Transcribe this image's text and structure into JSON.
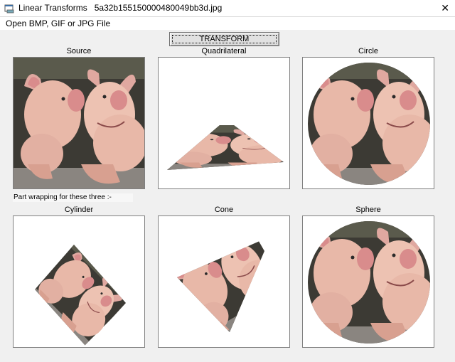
{
  "window": {
    "app_name": "Linear Transforms",
    "file_name": "5a32b155150000480049bb3d.jpg",
    "close_glyph": "✕"
  },
  "menu": {
    "open_label": "Open BMP, GIF or JPG File"
  },
  "toolbar": {
    "transform_label": "TRANSFORM"
  },
  "note": "Part wrapping for these three :-",
  "panels": [
    {
      "caption": "Source"
    },
    {
      "caption": "Quadrilateral"
    },
    {
      "caption": "Circle"
    },
    {
      "caption": "Cylinder"
    },
    {
      "caption": "Cone"
    },
    {
      "caption": "Sphere"
    }
  ],
  "colors": {
    "pig_skin": "#e8b8a8",
    "pig_shadow": "#b47a6a",
    "ear_inner": "#d98c8c",
    "background_dark": "#3c3a34",
    "ground": "#8a8580"
  },
  "icons": {
    "app": "app-window-icon",
    "close": "close-icon"
  }
}
